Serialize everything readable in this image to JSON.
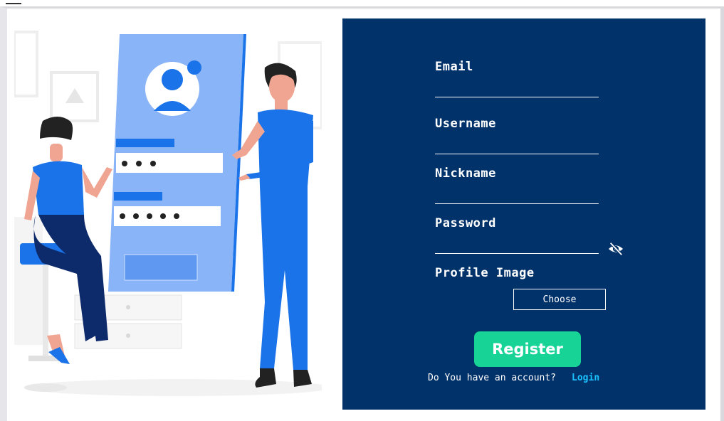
{
  "form": {
    "email_label": "Email",
    "username_label": "Username",
    "nickname_label": "Nickname",
    "password_label": "Password",
    "profile_image_label": "Profile Image",
    "choose_label": "Choose",
    "register_label": "Register",
    "account_prompt": "Do You have an account?",
    "login_label": "Login"
  },
  "icons": {
    "password_toggle": "eye-slash-icon"
  },
  "colors": {
    "panel_bg": "#02326a",
    "register_bg": "#17d496",
    "login_link": "#19c3ff",
    "illustration_blue": "#1a73e8"
  }
}
